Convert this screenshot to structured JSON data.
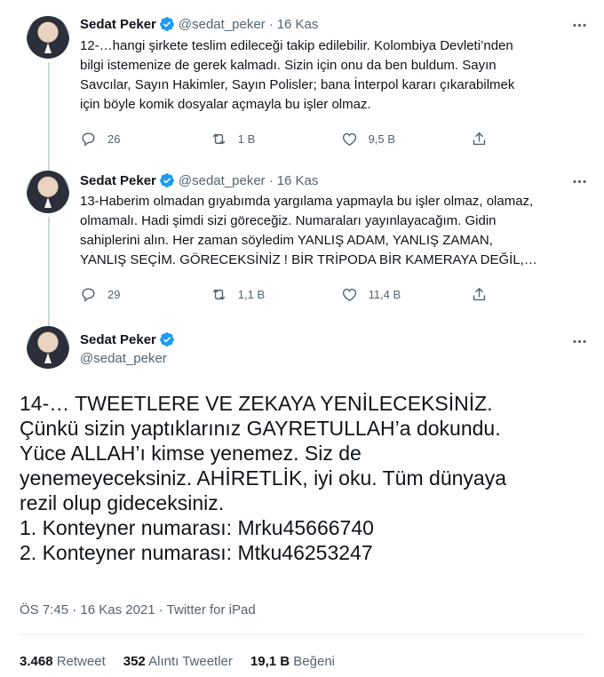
{
  "tweets": [
    {
      "name": "Sedat Peker",
      "handle": "@sedat_peker",
      "separator": "·",
      "date": "16 Kas",
      "text": "12-…hangi şirkete teslim edileceği takip edilebilir. Kolombiya Devleti’nden\nbilgi istemenize de gerek kalmadı. Sizin için onu da ben buldum. Sayın\nSavcılar, Sayın Hakimler, Sayın Polisler; bana İnterpol kararı çıkarabilmek\niçin böyle komik dosyalar açmayla bu işler olmaz.",
      "replies": "26",
      "retweets": "1 B",
      "likes": "9,5 B"
    },
    {
      "name": "Sedat Peker",
      "handle": "@sedat_peker",
      "separator": "·",
      "date": "16 Kas",
      "text": "13-Haberim olmadan gıyabımda yargılama yapmayla bu işler olmaz, olamaz,\nolmamalı. Hadi şimdi sizi göreceğiz. Numaraları yayınlayacağım. Gidin\nsahiplerini alın. Her zaman söyledim YANLIŞ ADAM, YANLIŞ ZAMAN,\nYANLIŞ SEÇİM. GÖRECEKSİNİZ ! BİR TRİPODA BİR KAMERAYA DEĞİL,…",
      "replies": "29",
      "retweets": "1,1 B",
      "likes": "11,4 B"
    }
  ],
  "main_tweet": {
    "name": "Sedat Peker",
    "handle": "@sedat_peker",
    "text": "14-… TWEETLERE VE ZEKAYA YENİLECEKSİNİZ.\nÇünkü sizin yaptıklarınız GAYRETULLAH’a dokundu.\nYüce ALLAH’ı kimse yenemez. Siz de\nyenemeyeceksiniz. AHİRETLİK, iyi oku. Tüm dünyaya\nrezil olup gideceksiniz.\n1. Konteyner numarası: Mrku45666740\n2. Konteyner numarası: Mtku46253247",
    "meta": "ÖS 7:45 · 16 Kas 2021 · Twitter for iPad",
    "stats": {
      "retweets_count": "3.468",
      "retweets_label": "Retweet",
      "quotes_count": "352",
      "quotes_label": "Alıntı Tweetler",
      "likes_count": "19,1 B",
      "likes_label": "Beğeni"
    }
  },
  "colors": {
    "text": "#0f1419",
    "secondary": "#536471",
    "verified": "#1d9bf0",
    "divider": "#eff3f4"
  },
  "icons": [
    "verified-badge-icon",
    "more-icon",
    "reply-icon",
    "retweet-icon",
    "like-icon",
    "share-icon"
  ]
}
